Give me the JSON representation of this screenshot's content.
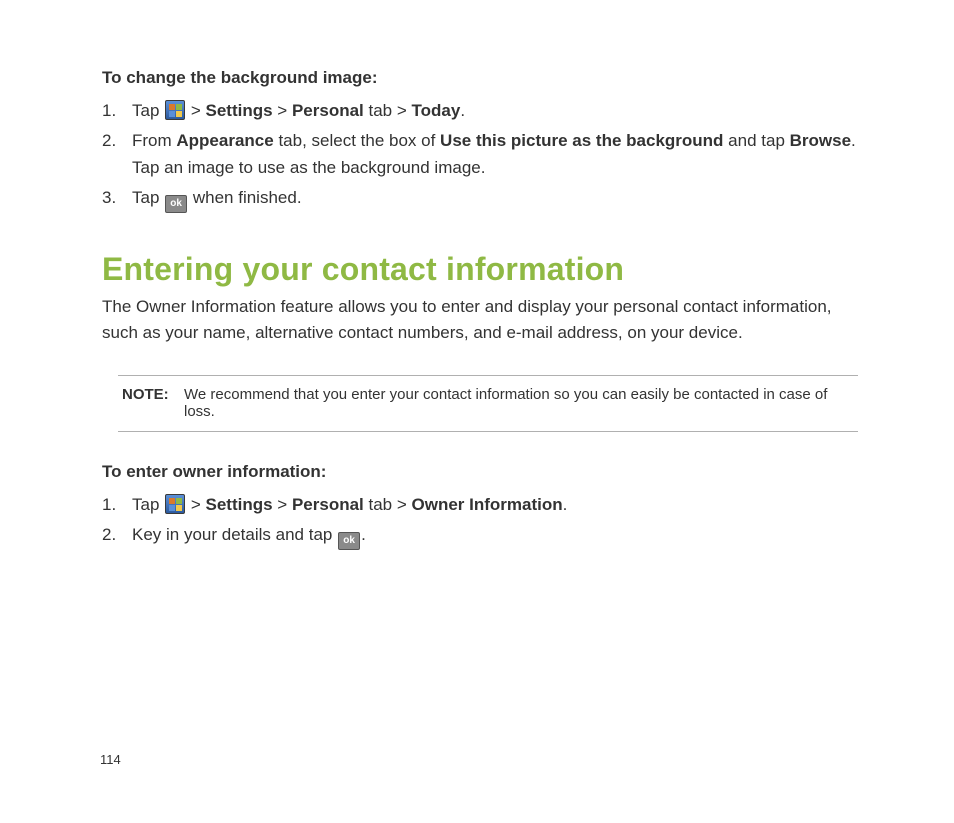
{
  "section1": {
    "heading": "To change the background image:",
    "steps": [
      {
        "num": "1.",
        "pre": "Tap ",
        "icon": "win",
        "sep1": " > ",
        "b1": "Settings",
        "sep2": " > ",
        "b2": "Personal",
        "mid1": " tab > ",
        "b3": "Today",
        "post": "."
      },
      {
        "num": "2.",
        "pre": "From ",
        "b1": "Appearance",
        "mid1": " tab, select the box of ",
        "b2": "Use this picture as the background",
        "mid2": " and tap ",
        "b3": "Browse",
        "post": ". Tap an image to use as the background image."
      },
      {
        "num": "3.",
        "pre": "Tap ",
        "icon": "ok",
        "post": " when finished."
      }
    ]
  },
  "section2": {
    "title": "Entering your contact information",
    "intro": "The Owner Information feature allows you to enter and display your personal contact information, such as your name,  alternative contact numbers, and e-mail address, on your device.",
    "note_label": "NOTE:",
    "note_text": "We recommend that you enter your contact information so you can easily be contacted in case of loss.",
    "heading2": "To enter owner information:",
    "steps": [
      {
        "num": "1.",
        "pre": "Tap ",
        "icon": "win",
        "sep1": " > ",
        "b1": "Settings",
        "sep2": " > ",
        "b2": "Personal",
        "mid1": " tab > ",
        "b3": "Owner Information",
        "post": "."
      },
      {
        "num": "2.",
        "pre": "Key in your details and tap ",
        "icon": "ok",
        "post": "."
      }
    ]
  },
  "ok_text": "ok",
  "page_number": "114"
}
